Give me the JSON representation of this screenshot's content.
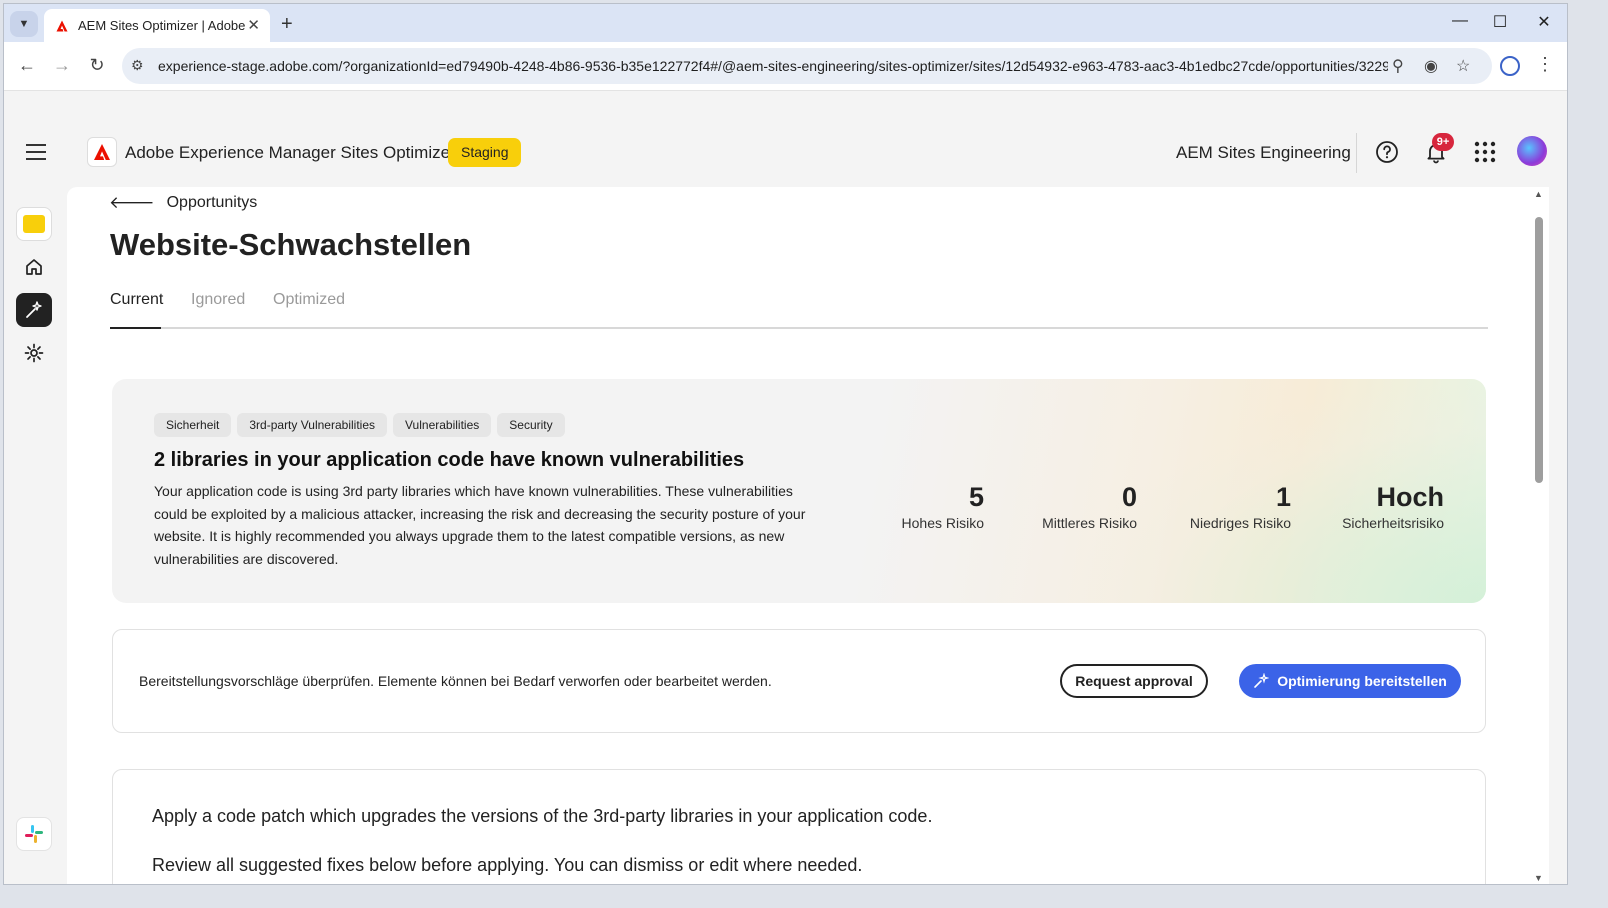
{
  "browser": {
    "tab_title": "AEM Sites Optimizer | Adobe Ex",
    "url": "experience-stage.adobe.com/?organizationId=ed79490b-4248-4b86-9536-b35e122772f4#/@aem-sites-engineering/sites-optimizer/sites/12d54932-e963-4783-aac3-4b1edbc27cde/opportunities/3229..."
  },
  "header": {
    "app_title": "Adobe Experience Manager Sites Optimizer",
    "env_badge": "Staging",
    "org_name": "AEM Sites Engineering",
    "notification_count": "9+"
  },
  "page": {
    "back_label": "Opportunitys",
    "title": "Website-Schwachstellen",
    "tabs": [
      {
        "label": "Current",
        "active": true
      },
      {
        "label": "Ignored",
        "active": false
      },
      {
        "label": "Optimized",
        "active": false
      }
    ]
  },
  "opportunity": {
    "tags": [
      "Sicherheit",
      "3rd-party Vulnerabilities",
      "Vulnerabilities",
      "Security"
    ],
    "heading": "2 libraries in your application code have known vulnerabilities",
    "description": "Your application code is using 3rd party libraries which have known vulnerabilities. These vulnerabilities could be exploited by a malicious attacker, increasing the risk and decreasing the security posture of your website. It is highly recommended you always upgrade them to the latest compatible versions, as new vulnerabilities are discovered.",
    "metrics": [
      {
        "value": "5",
        "label": "Hohes Risiko"
      },
      {
        "value": "0",
        "label": "Mittleres Risiko"
      },
      {
        "value": "1",
        "label": "Niedriges Risiko"
      },
      {
        "value": "Hoch",
        "label": "Sicherheitsrisiko"
      }
    ]
  },
  "action": {
    "text": "Bereitstellungsvorschläge überprüfen. Elemente können bei Bedarf verworfen oder bearbeitet werden.",
    "secondary_label": "Request approval",
    "primary_label": "Optimierung bereitstellen"
  },
  "patch": {
    "line1": "Apply a code patch which upgrades the versions of the 3rd-party libraries in your application code.",
    "line2": "Review all suggested fixes below before applying. You can dismiss or edit where needed."
  },
  "colors": {
    "accent": "#3b63e8",
    "staging": "#f8cf0b",
    "adobe_red": "#eb1000",
    "notification": "#d7263d"
  }
}
